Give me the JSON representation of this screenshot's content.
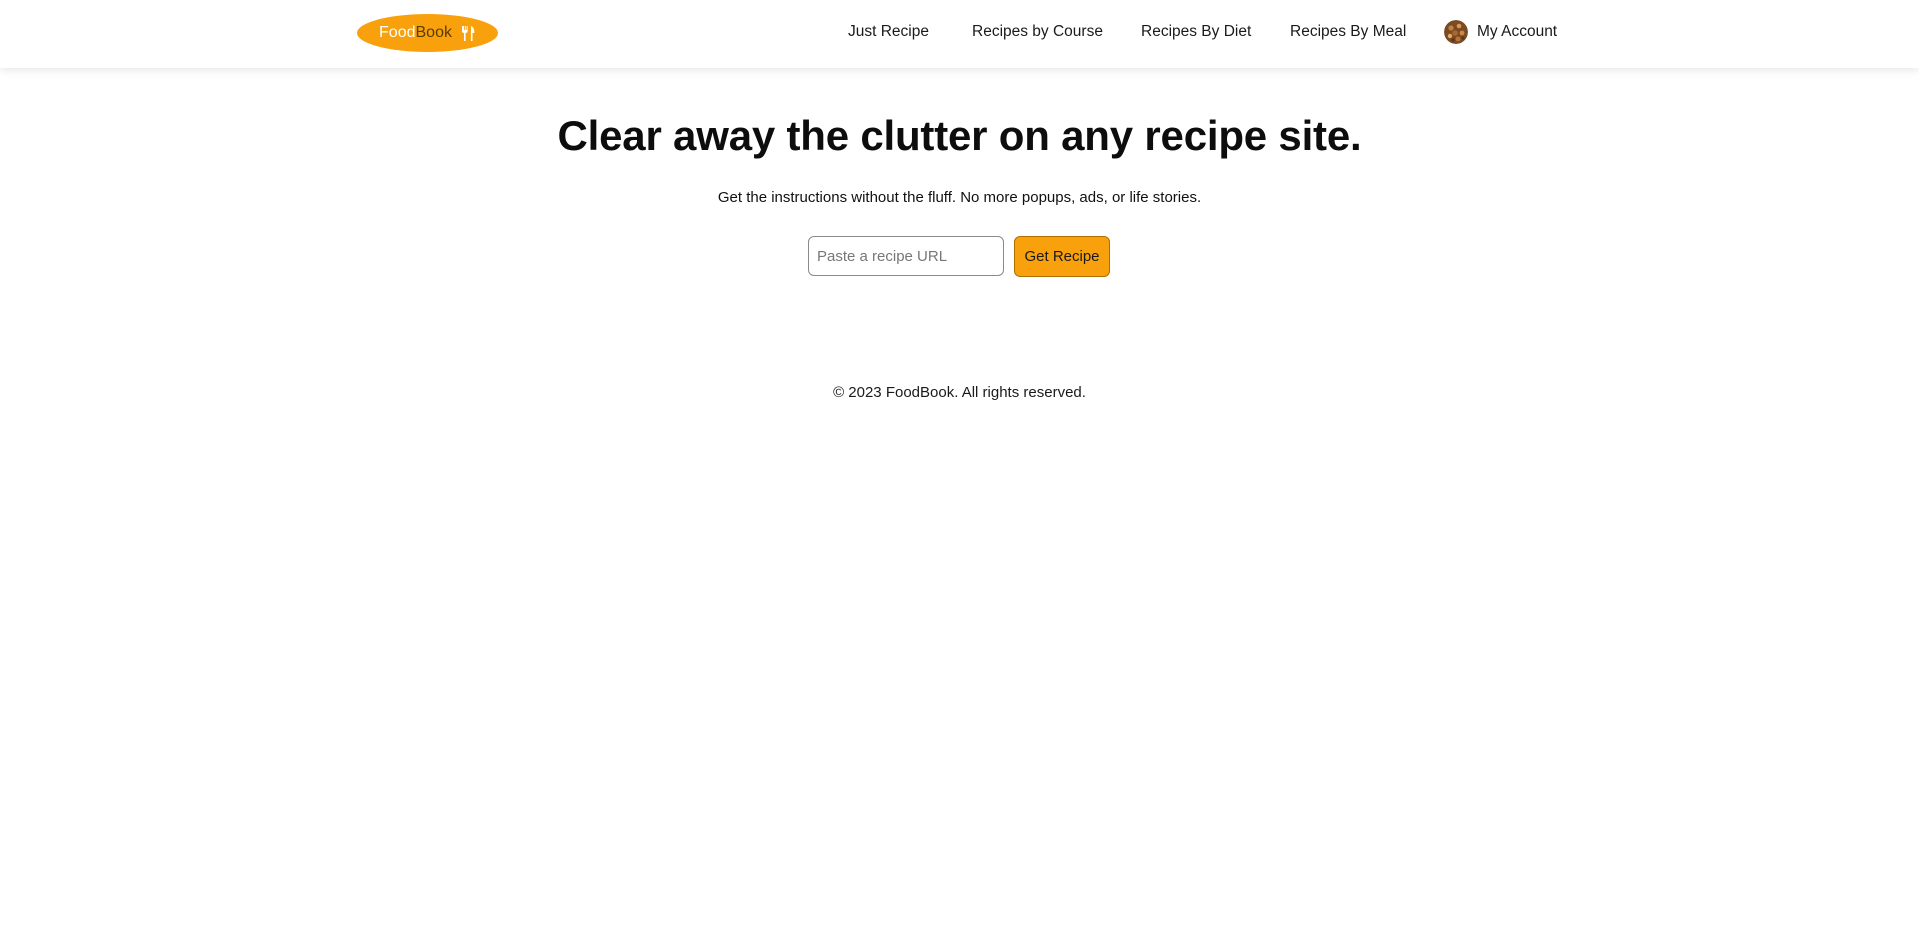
{
  "header": {
    "logo": {
      "word1": "Food",
      "word2": "Book",
      "icon": "fork-knife-icon",
      "color": "#f9a10d"
    },
    "nav": [
      {
        "label": "Just Recipe"
      },
      {
        "label": "Recipes by Course"
      },
      {
        "label": "Recipes By Diet"
      },
      {
        "label": "Recipes By Meal"
      }
    ],
    "account": {
      "label": "My Account",
      "avatar_icon": "avatar-image"
    }
  },
  "hero": {
    "title": "Clear away the clutter on any recipe site.",
    "subtitle": "Get the instructions without the fluff. No more popups, ads, or life stories.",
    "input": {
      "placeholder": "Paste a recipe URL",
      "value": ""
    },
    "button_label": "Get Recipe"
  },
  "footer": {
    "text": "© 2023 FoodBook. All rights reserved."
  }
}
